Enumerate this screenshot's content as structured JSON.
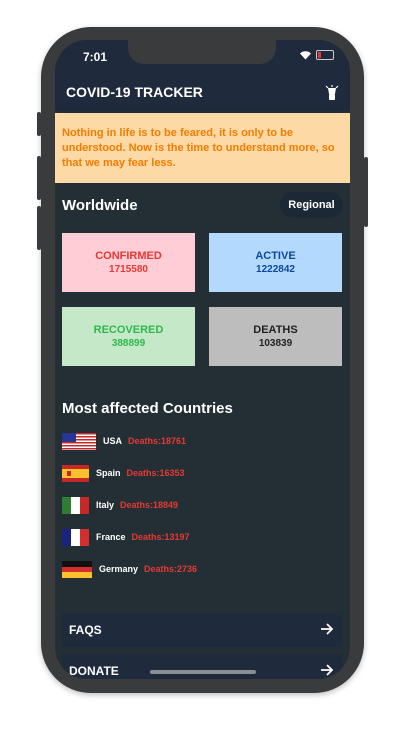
{
  "status_bar": {
    "time": "7:01"
  },
  "app_bar": {
    "title": "COVID-19 TRACKER",
    "theme_icon": "lightbulb-icon"
  },
  "quote": "Nothing in life is to be feared, it is only to be understood. Now is the time to understand more, so that we may fear less.",
  "worldwide": {
    "title": "Worldwide",
    "regional_label": "Regional",
    "stats": [
      {
        "label": "CONFIRMED",
        "value": "1715580",
        "bg": "#ffcdd6",
        "color": "#e53935"
      },
      {
        "label": "ACTIVE",
        "value": "1222842",
        "bg": "#b3dafc",
        "color": "#0d47a1"
      },
      {
        "label": "RECOVERED",
        "value": "388899",
        "bg": "#c5e8c8",
        "color": "#2eb84b"
      },
      {
        "label": "DEATHS",
        "value": "103839",
        "bg": "#bdbdbd",
        "color": "#222222"
      }
    ]
  },
  "most_affected": {
    "title": "Most affected Countries",
    "countries": [
      {
        "name": "USA",
        "deaths": "Deaths:18761",
        "flag": "usa-flag-icon"
      },
      {
        "name": "Spain",
        "deaths": "Deaths:16353",
        "flag": "spain-flag-icon"
      },
      {
        "name": "Italy",
        "deaths": "Deaths:18849",
        "flag": "italy-flag-icon"
      },
      {
        "name": "France",
        "deaths": "Deaths:13197",
        "flag": "france-flag-icon"
      },
      {
        "name": "Germany",
        "deaths": "Deaths:2736",
        "flag": "germany-flag-icon"
      }
    ]
  },
  "menu": [
    {
      "label": "FAQS",
      "icon": "arrow-right-icon"
    },
    {
      "label": "DONATE",
      "icon": "arrow-right-icon"
    }
  ]
}
